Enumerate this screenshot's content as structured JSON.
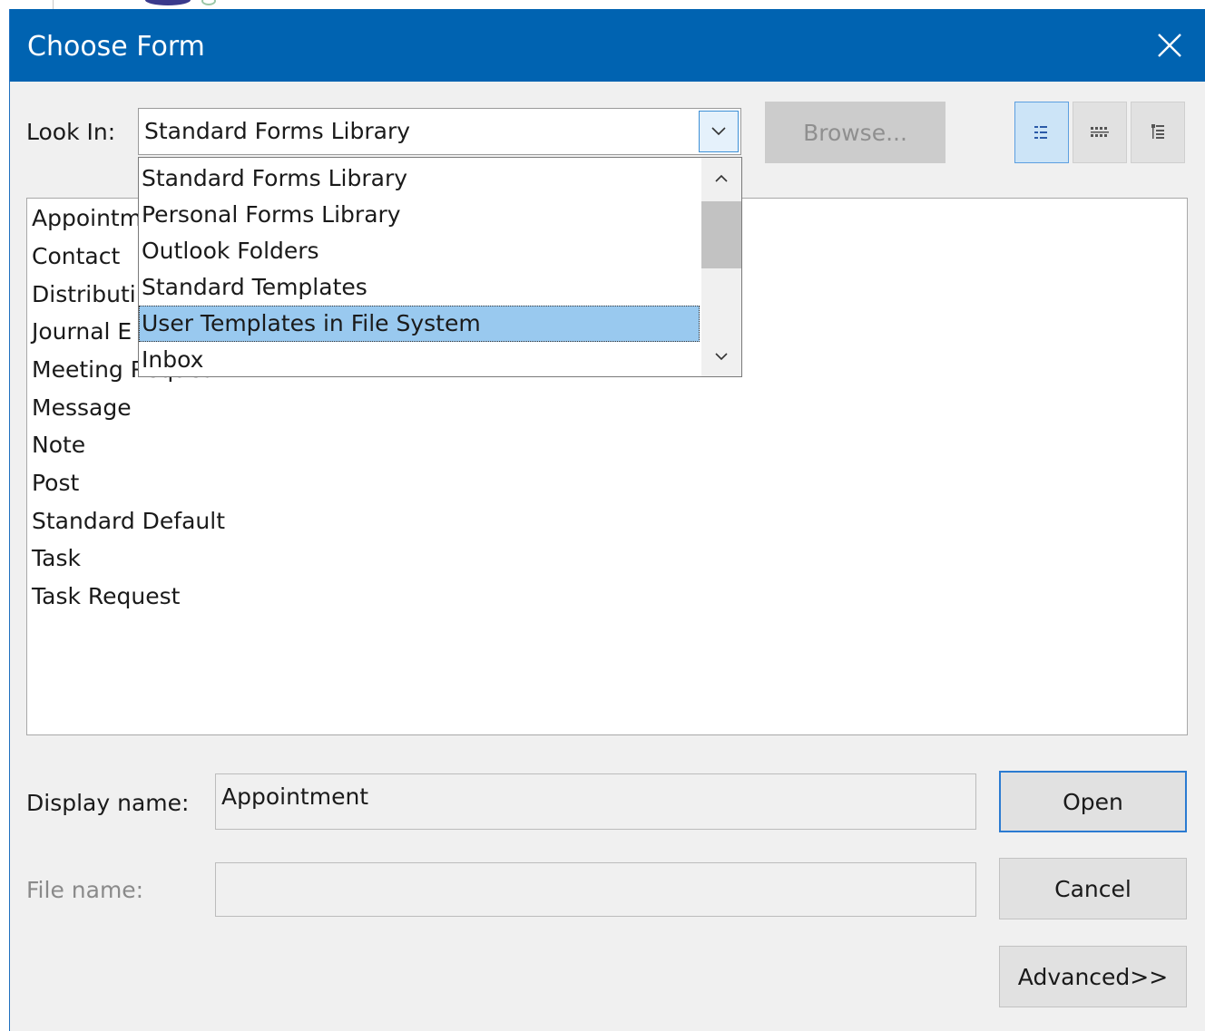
{
  "dialog": {
    "title": "Choose Form",
    "close_icon": "close-icon"
  },
  "look_in": {
    "label": "Look In:",
    "selected": "Standard Forms Library",
    "browse_label": "Browse...",
    "dropdown_options": [
      "Standard Forms Library",
      "Personal Forms Library",
      "Outlook Folders",
      "Standard Templates",
      "User Templates in File System",
      "Inbox"
    ],
    "highlighted_option": "User Templates in File System"
  },
  "view_buttons": [
    {
      "icon": "large-icons-view-icon",
      "active": true
    },
    {
      "icon": "small-icons-view-icon",
      "active": false
    },
    {
      "icon": "details-view-icon",
      "active": false
    }
  ],
  "form_list": {
    "items": [
      "Appointm",
      "Contact",
      "Distributi",
      "Journal E",
      "Meeting Request",
      "Message",
      "Note",
      "Post",
      "Standard Default",
      "Task",
      "Task Request"
    ]
  },
  "display_name": {
    "label": "Display name:",
    "value": "Appointment"
  },
  "file_name": {
    "label": "File name:",
    "value": ""
  },
  "buttons": {
    "open": "Open",
    "cancel": "Cancel",
    "advanced": "Advanced>>"
  },
  "colors": {
    "titlebar": "#0063b1",
    "selection": "#99c9ef",
    "dialog_bg": "#f0f0f0"
  }
}
